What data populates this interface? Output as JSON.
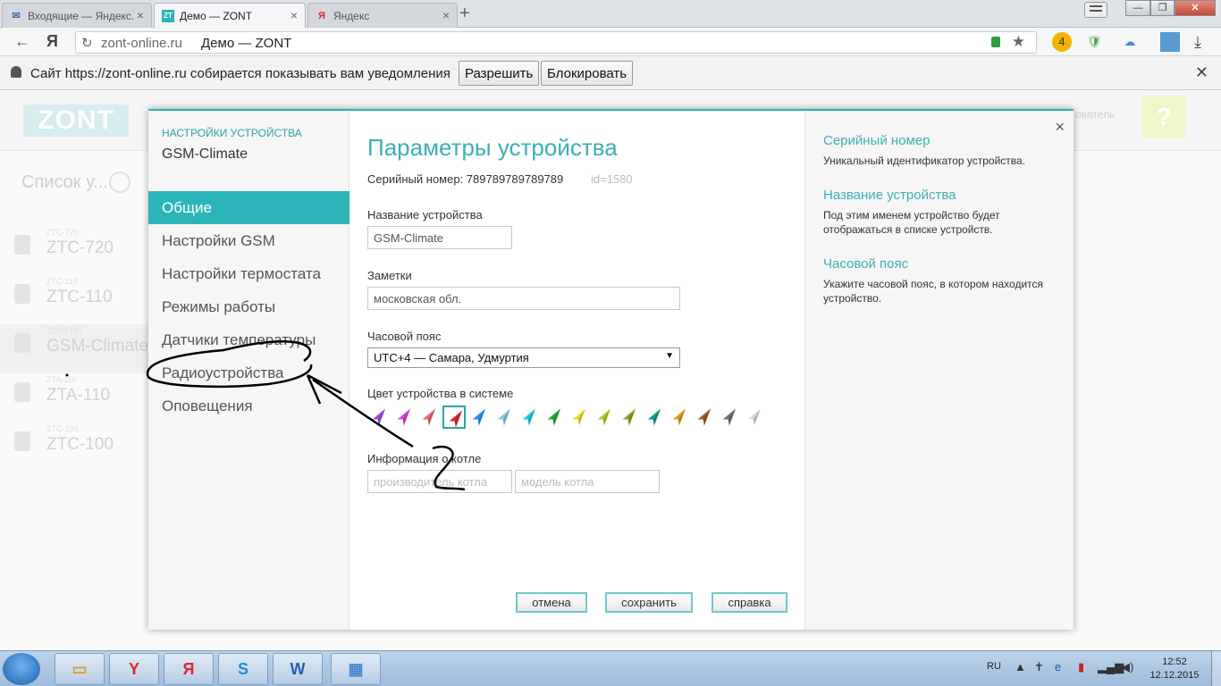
{
  "browser": {
    "tabs": [
      {
        "label": "Входящие — Яндекс.",
        "icon": "mail-icon"
      },
      {
        "label": "Демо — ZONT",
        "icon": "zont-icon"
      },
      {
        "label": "Яндекс",
        "icon": "yandex-icon"
      }
    ],
    "new_tab": "+",
    "url_domain": "zont-online.ru",
    "url_title": "Демо — ZONT",
    "ext_badge": "4"
  },
  "notification": {
    "text": "Сайт https://zont-online.ru собирается показывать вам уведомления",
    "allow": "Разрешить",
    "block": "Блокировать"
  },
  "page": {
    "logo": "ZONT",
    "user_label": "ователь",
    "help": "?",
    "list_title": "Список у...",
    "devices": [
      {
        "sub": "ZTC-720",
        "name": "ZTC-720"
      },
      {
        "sub": "ZTC-110",
        "name": "ZTC-110"
      },
      {
        "sub": "ZONT H-1",
        "name": "GSM-Climate"
      },
      {
        "sub": "ZTA-110",
        "name": "ZTA-110"
      },
      {
        "sub": "ZTC-100",
        "name": "ZTC-100"
      }
    ]
  },
  "modal": {
    "subtitle": "НАСТРОЙКИ УСТРОЙСТВА",
    "device": "GSM-Climate",
    "nav": [
      "Общие",
      "Настройки GSM",
      "Настройки термостата",
      "Режимы работы",
      "Датчики температуры",
      "Радиоустройства",
      "Оповещения"
    ],
    "title": "Параметры устройства",
    "serial": "Серийный номер: 789789789789789",
    "id": "id=1580",
    "name_label": "Название устройства",
    "name_value": "GSM-Climate",
    "notes_label": "Заметки",
    "notes_value": "московская обл.",
    "tz_label": "Часовой пояс",
    "tz_value": "UTC+4 — Самара, Удмуртия",
    "color_label": "Цвет устройства в системе",
    "colors": [
      "#9b4fd6",
      "#e040c8",
      "#e86a6a",
      "#e0242c",
      "#2a8fe0",
      "#8ac0e0",
      "#1ec8e0",
      "#1aa83a",
      "#e0e020",
      "#a8d020",
      "#90a020",
      "#1a9a8a",
      "#e09a20",
      "#a05a20",
      "#707070",
      "#d8d8d8"
    ],
    "selected_color": 3,
    "boiler_label": "Информация о котле",
    "boiler_maker_ph": "производитель котла",
    "boiler_model_ph": "модель котла",
    "btn_cancel": "отмена",
    "btn_save": "сохранить",
    "btn_help": "справка",
    "help": [
      {
        "title": "Серийный номер",
        "text": "Уникальный идентификатор устройства."
      },
      {
        "title": "Название устройства",
        "text": "Под этим именем устройство будет отображаться в списке устройств."
      },
      {
        "title": "Часовой пояс",
        "text": "Укажите часовой пояс, в котором находится устройство."
      }
    ],
    "close": "×"
  },
  "taskbar": {
    "lang": "RU",
    "time": "12:52",
    "date": "12.12.2015"
  }
}
